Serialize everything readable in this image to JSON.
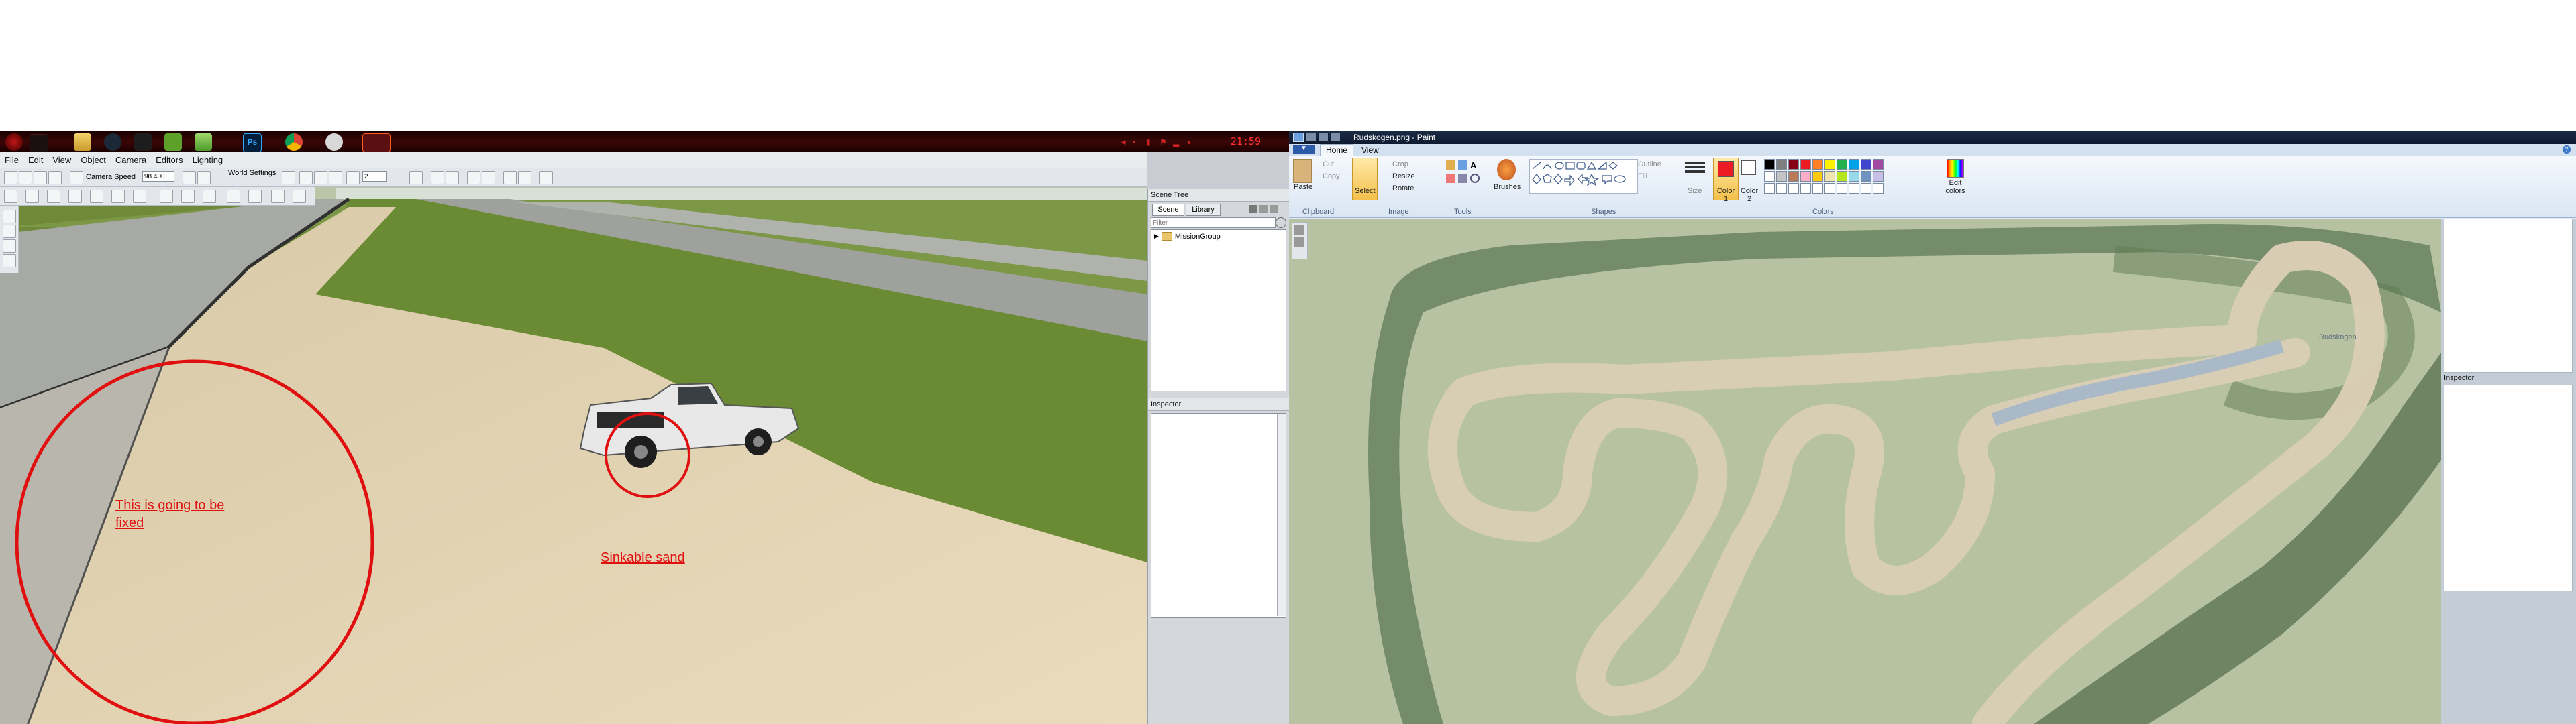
{
  "taskbar": {
    "clock": "21:59",
    "icons": [
      "start-icon",
      "explorer-icon",
      "steam-icon",
      "nvidia-icon",
      "notepad-icon",
      "photoshop-icon",
      "chrome-icon",
      "settings-icon",
      "beamng-icon"
    ],
    "photoshop_label": "Ps"
  },
  "editor": {
    "menu": [
      "File",
      "Edit",
      "View",
      "Object",
      "Camera",
      "Editors",
      "Lighting"
    ],
    "camera_speed_label": "Camera Speed",
    "camera_speed_value": "98.400",
    "world_settings_label": "World Settings",
    "grid_value": "2",
    "annotations": {
      "note_line1": "This is going to be",
      "note_line2": "fixed",
      "sand_label": "Sinkable sand"
    },
    "scene_panel": {
      "title": "Scene Tree",
      "tabs": [
        "Scene",
        "Library"
      ],
      "filter_placeholder": "Filter",
      "tree_root": "MissionGroup",
      "inspector_title": "Inspector"
    }
  },
  "paint": {
    "title": "Rudskogen.png - Paint",
    "tabs": [
      "Home",
      "View"
    ],
    "clipboard": {
      "paste": "Paste",
      "cut": "Cut",
      "copy": "Copy",
      "label": "Clipboard"
    },
    "image": {
      "select": "Select",
      "crop": "Crop",
      "resize": "Resize",
      "rotate": "Rotate",
      "label": "Image"
    },
    "tools_label": "Tools",
    "brushes_label": "Brushes",
    "shapes": {
      "outline": "Outline",
      "fill": "Fill",
      "label": "Shapes"
    },
    "size_label": "Size",
    "color1_label": "Color 1",
    "color2_label": "Color 2",
    "colors_label": "Colors",
    "edit_colors_label": "Edit colors",
    "palette": [
      "#000000",
      "#7f7f7f",
      "#880015",
      "#ed1c24",
      "#ff7f27",
      "#fff200",
      "#22b14c",
      "#00a2e8",
      "#3f48cc",
      "#a349a4",
      "#ffffff",
      "#c3c3c3",
      "#b97a57",
      "#ffaec9",
      "#ffc90e",
      "#efe4b0",
      "#b5e61d",
      "#99d9ea",
      "#7092be",
      "#c8bfe7"
    ],
    "color1": "#ed1c24",
    "color2": "#ffffff",
    "inspector_title": "Inspector",
    "map_label": "Rudskogen"
  }
}
